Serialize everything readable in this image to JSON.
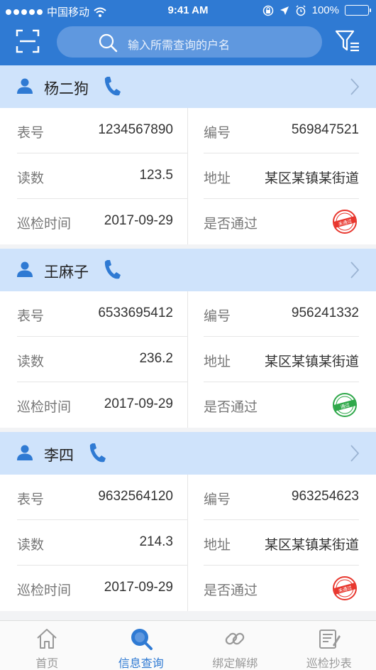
{
  "status_bar": {
    "carrier": "中国移动",
    "time": "9:41 AM",
    "battery": "100%"
  },
  "header": {
    "search_placeholder": "输入所需查询的户名",
    "scan_icon": "scan-icon",
    "filter_icon": "filter-icon"
  },
  "labels": {
    "meter_no": "表号",
    "number": "编号",
    "reading": "读数",
    "address": "地址",
    "inspect_time": "巡检时间",
    "passed": "是否通过"
  },
  "records": [
    {
      "name": "杨二狗",
      "meter_no": "1234567890",
      "number": "569847521",
      "reading": "123.5",
      "address": "某区某镇某街道",
      "inspect_time": "2017-09-29",
      "passed": false,
      "stamp_text": "未通过",
      "stamp_color": "#e8372e"
    },
    {
      "name": "王麻子",
      "meter_no": "6533695412",
      "number": "956241332",
      "reading": "236.2",
      "address": "某区某镇某街道",
      "inspect_time": "2017-09-29",
      "passed": true,
      "stamp_text": "通过",
      "stamp_color": "#2fa84a"
    },
    {
      "name": "李四",
      "meter_no": "9632564120",
      "number": "963254623",
      "reading": "214.3",
      "address": "某区某镇某街道",
      "inspect_time": "2017-09-29",
      "passed": false,
      "stamp_text": "未通过",
      "stamp_color": "#e8372e"
    }
  ],
  "tabs": [
    {
      "label": "首页",
      "icon": "home-icon",
      "active": false
    },
    {
      "label": "信息查询",
      "icon": "search-icon",
      "active": true
    },
    {
      "label": "绑定解绑",
      "icon": "link-icon",
      "active": false
    },
    {
      "label": "巡检抄表",
      "icon": "notes-icon",
      "active": false
    }
  ],
  "colors": {
    "primary": "#2f7ad3",
    "card_header": "#cfe3fb",
    "tab_inactive": "#999999"
  }
}
